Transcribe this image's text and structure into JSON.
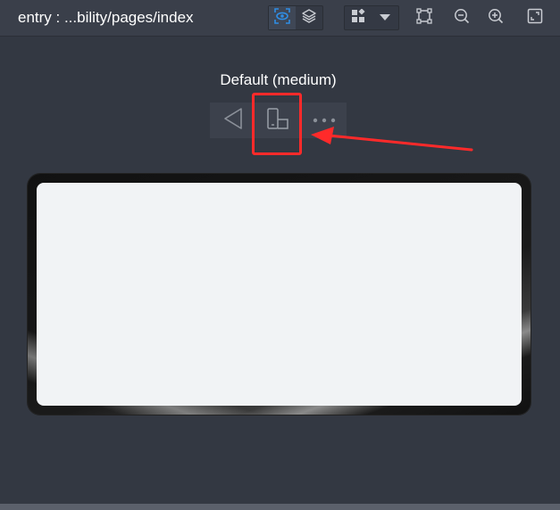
{
  "toolbar": {
    "title": "entry : ...bility/pages/index",
    "view_toggle": {
      "items": [
        {
          "name": "eye-view-icon",
          "active": true
        },
        {
          "name": "layers-icon",
          "active": false
        }
      ]
    },
    "component_dropdown": {
      "icon": "grid-components-icon",
      "caret": "chevron-down-icon"
    },
    "tools": [
      "crop-frame-icon",
      "zoom-out-icon",
      "zoom-in-icon",
      "fit-screen-icon"
    ],
    "accent_color": "#2f8ee5"
  },
  "device": {
    "label": "Default (medium)",
    "controls": [
      "back-triangle-icon",
      "rotate-device-icon",
      "more-dots-icon"
    ]
  },
  "annotation": {
    "color": "#ff2a2a"
  }
}
